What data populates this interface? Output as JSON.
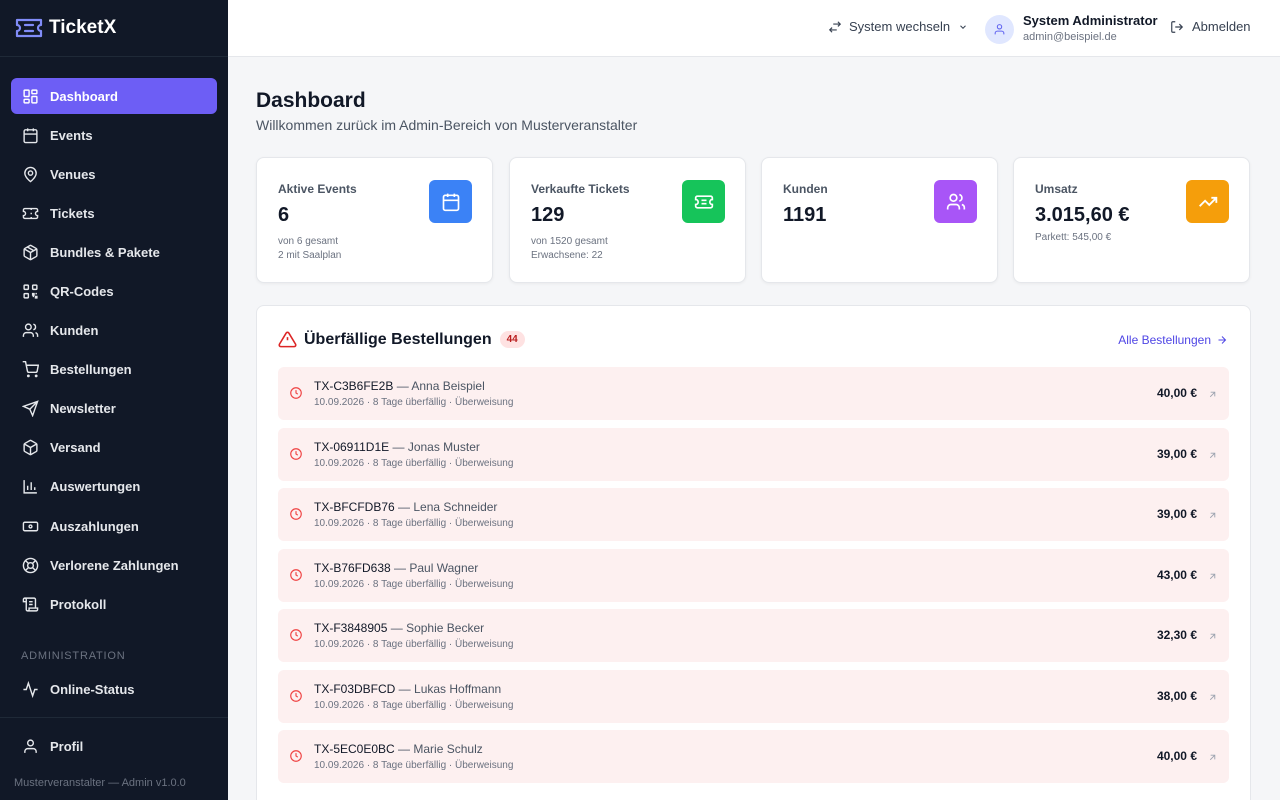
{
  "app": {
    "name": "TicketX",
    "footer": "Musterveranstalter — Admin v1.0.0"
  },
  "sidebar": {
    "items": [
      {
        "label": "Dashboard",
        "icon": "dashboard-icon"
      },
      {
        "label": "Events",
        "icon": "calendar-icon"
      },
      {
        "label": "Venues",
        "icon": "map-pin-icon"
      },
      {
        "label": "Tickets",
        "icon": "ticket-icon"
      },
      {
        "label": "Bundles & Pakete",
        "icon": "package-icon"
      },
      {
        "label": "QR-Codes",
        "icon": "qr-code-icon"
      },
      {
        "label": "Kunden",
        "icon": "user-icon"
      },
      {
        "label": "Bestellungen",
        "icon": "cart-icon"
      },
      {
        "label": "Newsletter",
        "icon": "send-icon"
      },
      {
        "label": "Versand",
        "icon": "box-icon"
      },
      {
        "label": "Auswertungen",
        "icon": "bar-chart-icon"
      },
      {
        "label": "Auszahlungen",
        "icon": "banknote-icon"
      },
      {
        "label": "Verlorene Zahlungen",
        "icon": "lifebuoy-icon"
      },
      {
        "label": "Protokoll",
        "icon": "scroll-icon"
      }
    ],
    "section_label": "ADMINISTRATION",
    "admin_items": [
      {
        "label": "Online-Status",
        "icon": "activity-icon"
      }
    ],
    "bottom_items": [
      {
        "label": "Profil",
        "icon": "user-icon"
      }
    ]
  },
  "topbar": {
    "switch_label": "System wechseln",
    "user_name": "System Administrator",
    "user_email": "admin@beispiel.de",
    "logout_label": "Abmelden"
  },
  "page": {
    "title": "Dashboard",
    "subtitle": "Willkommen zurück im Admin-Bereich von Musterveranstalter"
  },
  "stats": [
    {
      "label": "Aktive Events",
      "value": "6",
      "sub1": "von 6 gesamt",
      "sub2": "2 mit Saalplan",
      "color": "#3b82f6",
      "icon": "calendar-icon"
    },
    {
      "label": "Verkaufte Tickets",
      "value": "129",
      "sub1": "von 1520 gesamt",
      "sub2": "Erwachsene: 22",
      "color": "#16c45a",
      "icon": "ticket-icon"
    },
    {
      "label": "Kunden",
      "value": "1191",
      "sub1": "",
      "sub2": "",
      "color": "#a855f7",
      "icon": "users-icon"
    },
    {
      "label": "Umsatz",
      "value": "3.015,60 €",
      "sub1": "Parkett: 545,00 €",
      "sub2": "",
      "color": "#f59e0b",
      "icon": "trending-up-icon"
    }
  ],
  "overdue": {
    "title": "Überfällige Bestellungen",
    "count": "44",
    "link_label": "Alle Bestellungen",
    "orders": [
      {
        "id": "TX-C3B6FE2B",
        "separator": " — ",
        "customer": "Anna Beispiel",
        "details": "10.09.2026 · 8 Tage überfällig · Überweisung",
        "amount": "40,00 €"
      },
      {
        "id": "TX-06911D1E",
        "separator": " — ",
        "customer": "Jonas Muster",
        "details": "10.09.2026 · 8 Tage überfällig · Überweisung",
        "amount": "39,00 €"
      },
      {
        "id": "TX-BFCFDB76",
        "separator": " — ",
        "customer": "Lena Schneider",
        "details": "10.09.2026 · 8 Tage überfällig · Überweisung",
        "amount": "39,00 €"
      },
      {
        "id": "TX-B76FD638",
        "separator": " — ",
        "customer": "Paul Wagner",
        "details": "10.09.2026 · 8 Tage überfällig · Überweisung",
        "amount": "43,00 €"
      },
      {
        "id": "TX-F3848905",
        "separator": " — ",
        "customer": "Sophie Becker",
        "details": "10.09.2026 · 8 Tage überfällig · Überweisung",
        "amount": "32,30 €"
      },
      {
        "id": "TX-F03DBFCD",
        "separator": " — ",
        "customer": "Lukas Hoffmann",
        "details": "10.09.2026 · 8 Tage überfällig · Überweisung",
        "amount": "38,00 €"
      },
      {
        "id": "TX-5EC0E0BC",
        "separator": " — ",
        "customer": "Marie Schulz",
        "details": "10.09.2026 · 8 Tage überfällig · Überweisung",
        "amount": "40,00 €"
      }
    ]
  }
}
